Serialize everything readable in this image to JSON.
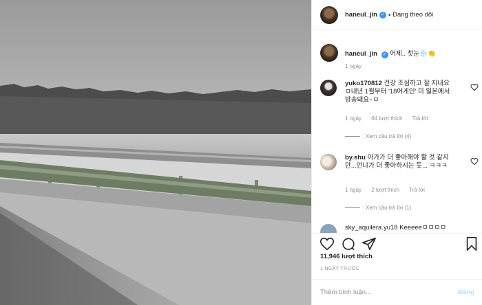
{
  "header": {
    "username": "haneul_jin",
    "verified_mark": "✓",
    "separator": "•",
    "follow_status": "Đang theo dõi"
  },
  "caption": {
    "username": "haneul_jin",
    "text": "어제.. 첫눈❄️👏",
    "time": "1 ngày"
  },
  "comments": [
    {
      "username": "yuko170812",
      "text": "건강 조심하고 잘 지내요ㅁ내년 1월부터 '18어게인' 미 일본에서 방송돼요~ㅁ",
      "time": "1 ngày",
      "likes": "64 lượt thích",
      "reply": "Trả lời",
      "view_replies": "Xem câu trả lời (4)"
    },
    {
      "username": "by.shu",
      "text": "아가가 더 좋아해야 할 것 같지만...언냐가 더 좋아하시는 듯... ㅋㅋㅋ",
      "time": "1 ngày",
      "likes": "2 lượt thích",
      "reply": "Trả lời",
      "view_replies": "Xem câu trả lời (1)"
    }
  ],
  "partial_comment": {
    "text": "sky_aquilera.yu18 Keeeeeㅁㅁㅁㅁ"
  },
  "stats": {
    "likes": "11,946 lượt thích",
    "posted": "1 NGÀY TRƯỚC"
  },
  "composer": {
    "placeholder": "Thêm bình luận...",
    "post_label": "Đăng"
  },
  "icons": {
    "like": "heart-icon",
    "comment": "comment-icon",
    "share": "share-icon",
    "save": "bookmark-icon"
  },
  "colors": {
    "verified": "#3897f0",
    "meta": "#8e8e8e",
    "post_disabled": "#b2dffc"
  }
}
